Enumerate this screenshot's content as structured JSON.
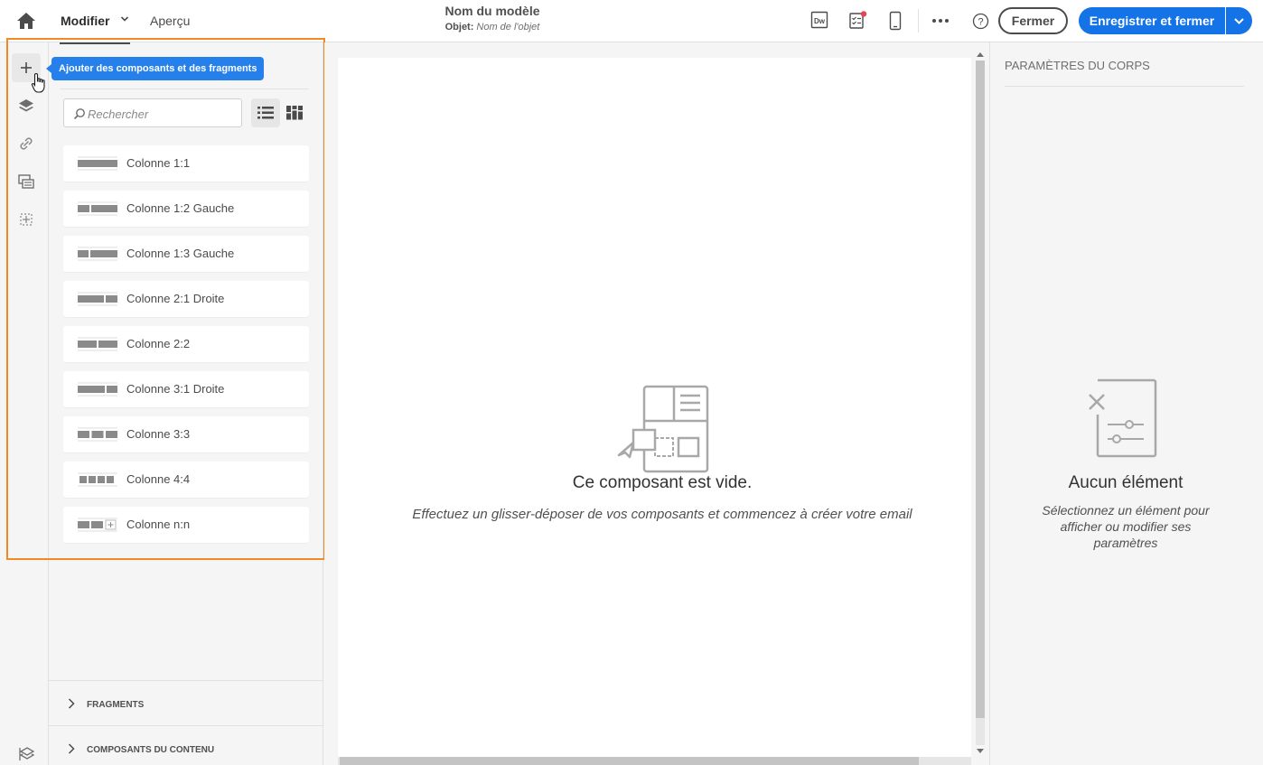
{
  "header": {
    "menu_modifier": "Modifier",
    "menu_apercu": "Aperçu",
    "template_name": "Nom du modèle",
    "subject_label": "Objet:",
    "subject_value": "Nom de l'objet",
    "fermer_label": "Fermer",
    "save_label": "Enregistrer et fermer",
    "icons": [
      "home-icon",
      "dreamweaver-icon",
      "checklist-icon",
      "mobile-preview-icon",
      "more-icon",
      "help-icon"
    ],
    "accent_color": "#1473e6",
    "notification_color": "#e34850"
  },
  "rail": {
    "items": [
      "add-components-icon",
      "layers-icon",
      "link-icon",
      "assets-icon",
      "structure-icon"
    ],
    "bottom_icon": "settings-layers-icon"
  },
  "tooltip": "Ajouter des composants et des fragments",
  "highlight_color": "#f08a24",
  "search": {
    "placeholder": "Rechercher"
  },
  "components": [
    {
      "label": "Colonne 1:1",
      "thumb": "1:1"
    },
    {
      "label": "Colonne 1:2 Gauche",
      "thumb": "1:2"
    },
    {
      "label": "Colonne 1:3 Gauche",
      "thumb": "1:3"
    },
    {
      "label": "Colonne 2:1 Droite",
      "thumb": "2:1"
    },
    {
      "label": "Colonne 2:2",
      "thumb": "2:2"
    },
    {
      "label": "Colonne 3:1 Droite",
      "thumb": "3:1"
    },
    {
      "label": "Colonne 3:3",
      "thumb": "3:3"
    },
    {
      "label": "Colonne 4:4",
      "thumb": "4:4"
    },
    {
      "label": "Colonne n:n",
      "thumb": "n:n"
    }
  ],
  "accordions": [
    {
      "label": "FRAGMENTS"
    },
    {
      "label": "COMPOSANTS DU CONTENU"
    }
  ],
  "canvas": {
    "empty_title": "Ce composant est vide.",
    "empty_subtitle": "Effectuez un glisser-déposer de vos composants et commencez à créer votre email"
  },
  "right_panel": {
    "title": "PARAMÈTRES DU CORPS",
    "empty_title": "Aucun élément",
    "empty_subtitle": "Sélectionnez un élément pour afficher ou modifier ses paramètres"
  }
}
